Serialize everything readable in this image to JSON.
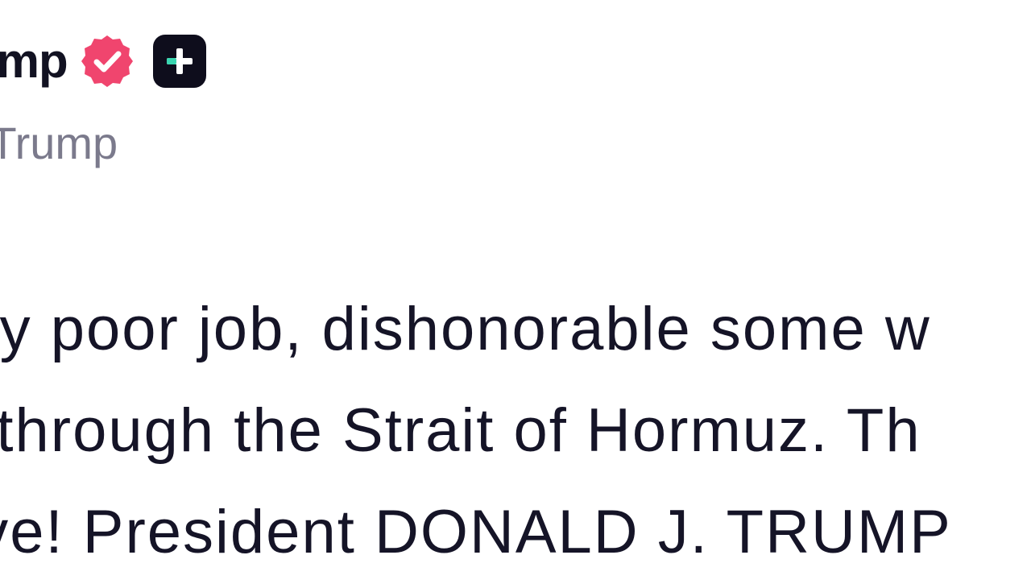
{
  "post": {
    "display_name": "ump",
    "handle": "lTrump",
    "body_lines": [
      "ery poor job, dishonorable some w",
      "o through the Strait of Hormuz. Th",
      "ave! President DONALD J. TRUMP"
    ],
    "badges": {
      "verified_icon": "verified-check-icon",
      "verified_color": "#f0456e",
      "plus_icon": "plus-badge-icon",
      "plus_color": "#0e0d1c",
      "plus_accent": "#39d5b0"
    }
  },
  "colors": {
    "name_text": "#121222",
    "handle_text": "#7b7a8c",
    "body_text": "#151427",
    "background": "#ffffff"
  }
}
